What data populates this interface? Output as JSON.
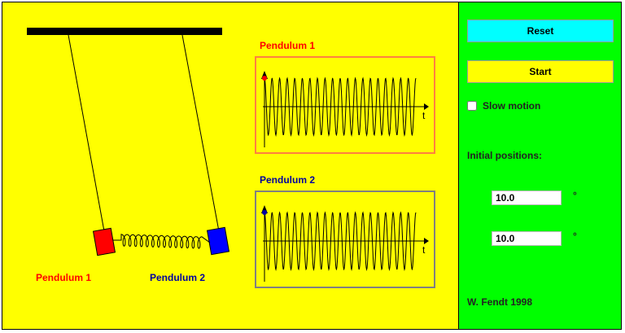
{
  "simulation": {
    "pendulum1_label": "Pendulum 1",
    "pendulum2_label": "Pendulum 2",
    "colors": {
      "pendulum1": "#ff0000",
      "pendulum2": "#0000ff",
      "background": "#ffff00"
    }
  },
  "graphs": {
    "graph1": {
      "title": "Pendulum 1",
      "axis_label": "t",
      "border_color": "#ff8040"
    },
    "graph2": {
      "title": "Pendulum 2",
      "axis_label": "t",
      "border_color": "#808080"
    }
  },
  "controls": {
    "reset_label": "Reset",
    "start_label": "Start",
    "slow_motion_label": "Slow motion",
    "initial_positions_label": "Initial positions:",
    "pendulum1_value": "10.0",
    "pendulum2_value": "10.0",
    "unit": "°",
    "credit": "W. Fendt 1998",
    "colors": {
      "reset": "#00ffff",
      "start": "#ffff00",
      "panel": "#00ff00"
    }
  }
}
